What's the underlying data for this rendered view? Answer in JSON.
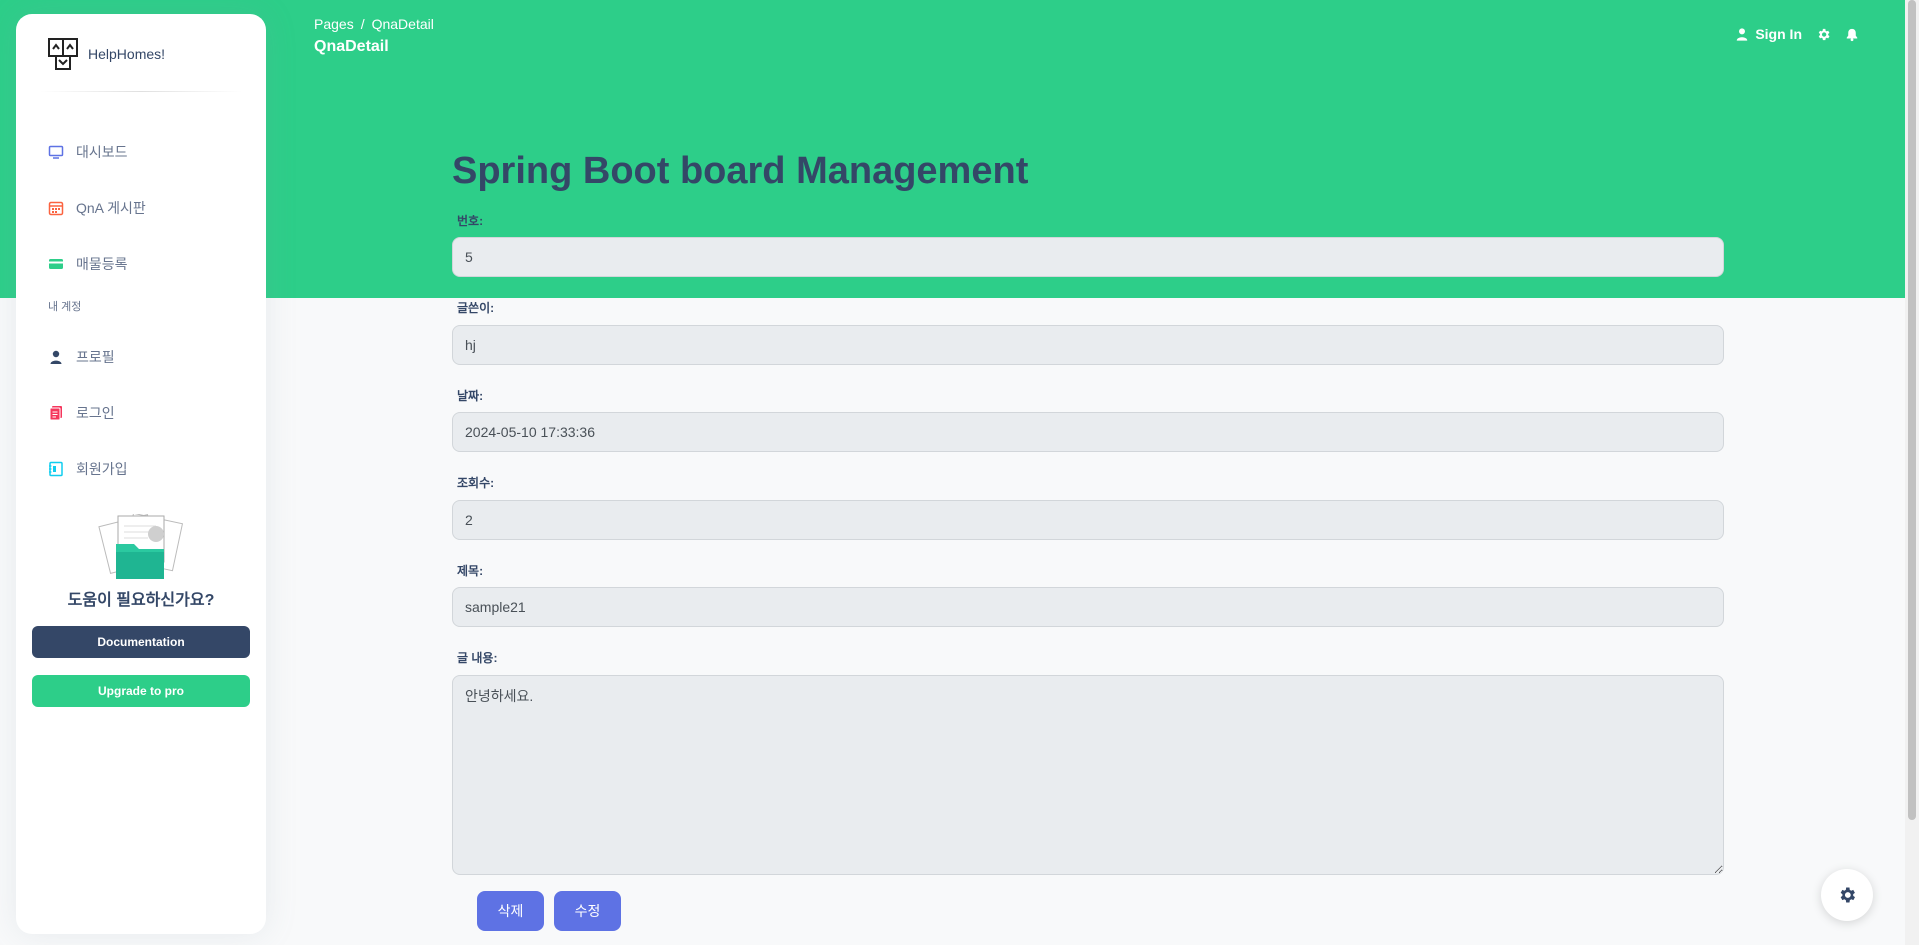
{
  "brand": {
    "name": "HelpHomes!"
  },
  "sidebar": {
    "items": [
      {
        "label": "대시보드",
        "icon": "monitor-icon",
        "color": "#5e72e4"
      },
      {
        "label": "QnA 게시판",
        "icon": "calendar-icon",
        "color": "#fb6340"
      },
      {
        "label": "매물등록",
        "icon": "credit-card-icon",
        "color": "#2dce89"
      }
    ],
    "section_label": "내 계정",
    "account_items": [
      {
        "label": "프로필",
        "icon": "user-icon",
        "color": "#344767"
      },
      {
        "label": "로그인",
        "icon": "document-icon",
        "color": "#f5365c"
      },
      {
        "label": "회원가입",
        "icon": "collection-icon",
        "color": "#11cdef"
      }
    ],
    "help": {
      "title": "도움이 필요하신가요?",
      "doc_button": "Documentation",
      "upgrade_button": "Upgrade to pro"
    }
  },
  "header": {
    "breadcrumb_root": "Pages",
    "breadcrumb_separator": "/",
    "breadcrumb_current": "QnaDetail",
    "page_title": "QnaDetail",
    "sign_in": "Sign In"
  },
  "main": {
    "title": "Spring Boot board Management",
    "fields": {
      "number": {
        "label": "번호:",
        "value": "5"
      },
      "writer": {
        "label": "글쓴이:",
        "value": "hj"
      },
      "date": {
        "label": "날짜:",
        "value": "2024-05-10 17:33:36"
      },
      "views": {
        "label": "조회수:",
        "value": "2"
      },
      "subject": {
        "label": "제목:",
        "value": "sample21"
      },
      "content": {
        "label": "글 내용:",
        "value": "안녕하세요."
      }
    },
    "delete_button": "삭제",
    "edit_button": "수정"
  },
  "colors": {
    "hero": "#2dce89",
    "primary": "#5e72e4",
    "dark": "#344767"
  }
}
